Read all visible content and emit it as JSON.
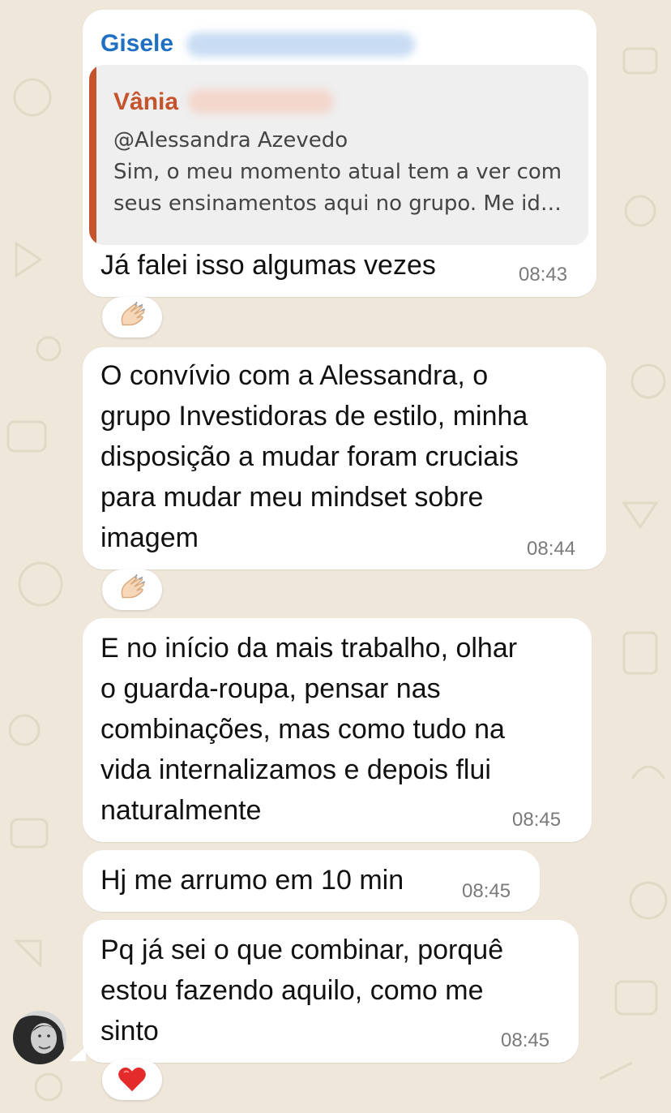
{
  "colors": {
    "background": "#efe7da",
    "bubble": "#ffffff",
    "sender_name": "#1f6fc3",
    "quote_accent": "#c5532c",
    "timestamp": "#7a7a7a"
  },
  "messages": [
    {
      "sender": "Gisele",
      "reply": {
        "name": "Vânia",
        "lines": [
          "@Alessandra Azevedo",
          "Sim, o meu momento atual tem a ver com",
          "seus ensinamentos aqui no grupo. Me id…"
        ]
      },
      "lines": [
        "Já falei isso algumas vezes"
      ],
      "time": "08:43",
      "reaction": "clapping-hands"
    },
    {
      "lines": [
        "O convívio com a Alessandra, o",
        "grupo Investidoras de estilo, minha",
        "disposição a mudar foram cruciais",
        "para mudar meu mindset sobre",
        "imagem"
      ],
      "time": "08:44",
      "reaction": "clapping-hands"
    },
    {
      "lines": [
        "E no início da mais trabalho, olhar",
        "o guarda-roupa, pensar nas",
        "combinações, mas como tudo na",
        "vida internalizamos e depois flui",
        "naturalmente"
      ],
      "time": "08:45"
    },
    {
      "lines": [
        "Hj me arrumo em 10 min"
      ],
      "time": "08:45"
    },
    {
      "lines": [
        "Pq já sei o que combinar, porquê",
        "estou fazendo aquilo, como me",
        "sinto"
      ],
      "time": "08:45",
      "reaction": "red-heart"
    }
  ]
}
